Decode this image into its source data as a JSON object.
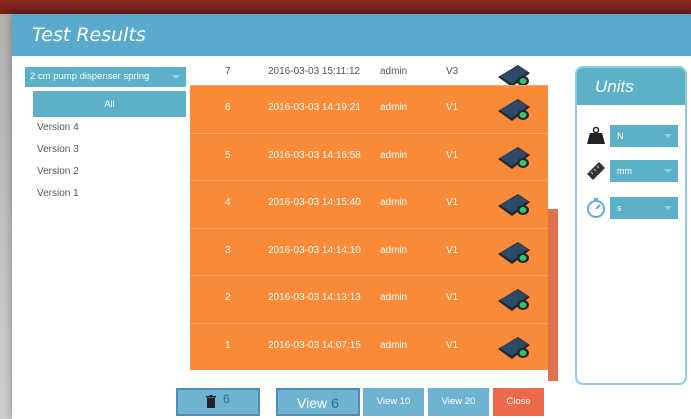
{
  "dialog": {
    "title": "Test Results"
  },
  "spring_select": {
    "value": "2 cm pump dispenser spring"
  },
  "versions": {
    "all_label": "All",
    "items": [
      "Version 4",
      "Version 3",
      "Version 2",
      "Version 1"
    ]
  },
  "results": [
    {
      "num": "7",
      "datetime": "2016-03-03 15:11:12",
      "user": "admin",
      "version": "V3",
      "selected": false
    },
    {
      "num": "6",
      "datetime": "2016-03-03 14:19:21",
      "user": "admin",
      "version": "V1",
      "selected": true
    },
    {
      "num": "5",
      "datetime": "2016-03-03 14:16:58",
      "user": "admin",
      "version": "V1",
      "selected": true
    },
    {
      "num": "4",
      "datetime": "2016-03-03 14:15:40",
      "user": "admin",
      "version": "V1",
      "selected": true
    },
    {
      "num": "3",
      "datetime": "2016-03-03 14:14:10",
      "user": "admin",
      "version": "V1",
      "selected": true
    },
    {
      "num": "2",
      "datetime": "2016-03-03 14:13:13",
      "user": "admin",
      "version": "V1",
      "selected": true
    },
    {
      "num": "1",
      "datetime": "2016-03-03 14:07:15",
      "user": "admin",
      "version": "V1",
      "selected": true
    }
  ],
  "units": {
    "title": "Units",
    "force": {
      "icon": "weight-icon",
      "value": "N"
    },
    "distance": {
      "icon": "ruler-icon",
      "value": "mm"
    },
    "time": {
      "icon": "stopwatch-icon",
      "value": "s"
    }
  },
  "buttons": {
    "delete_count": "6",
    "view_label": "View",
    "view_count": "6",
    "view10_label": "View 10",
    "view20_label": "View 20",
    "close_label": "Close"
  },
  "colors": {
    "accent": "#5cb0c8",
    "selected_row": "#f88a38",
    "close": "#ec6a4a"
  }
}
